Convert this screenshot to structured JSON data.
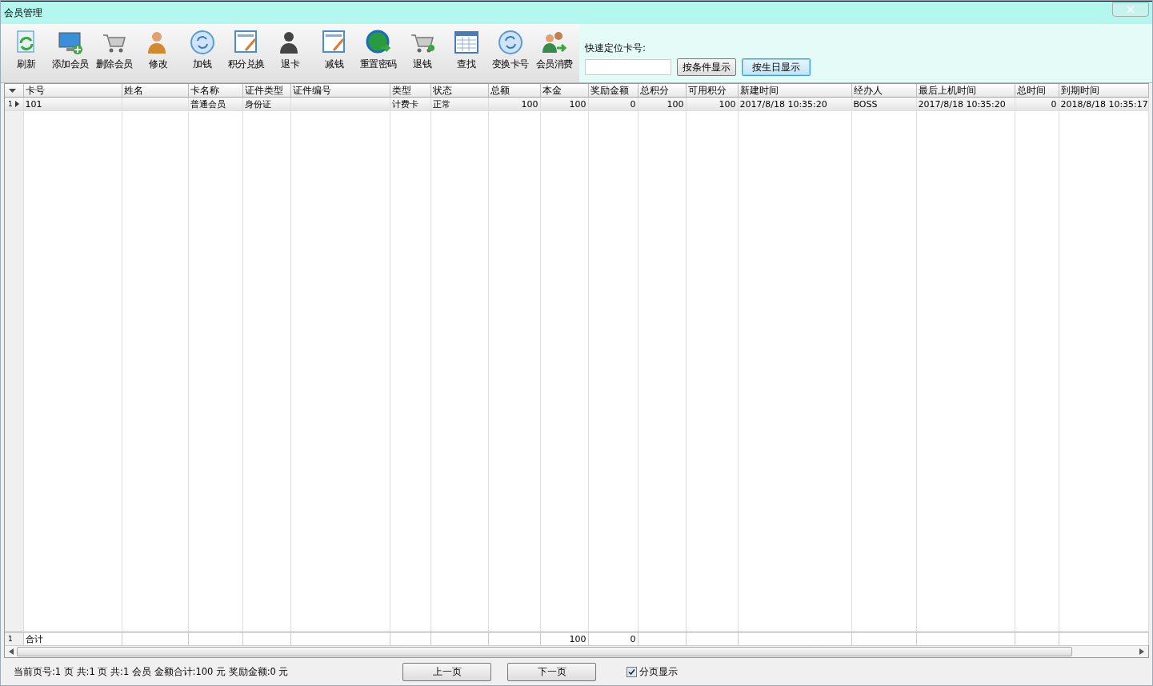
{
  "window": {
    "title": "会员管理"
  },
  "toolbar": [
    {
      "label": "刷新"
    },
    {
      "label": "添加会员"
    },
    {
      "label": "删除会员"
    },
    {
      "label": "修改"
    },
    {
      "label": "加钱"
    },
    {
      "label": "积分兑换"
    },
    {
      "label": "退卡"
    },
    {
      "label": "减钱"
    },
    {
      "label": "重置密码"
    },
    {
      "label": "退钱"
    },
    {
      "label": "查找"
    },
    {
      "label": "变换卡号"
    },
    {
      "label": "会员消费"
    }
  ],
  "quick_locate": {
    "label": "快速定位卡号:"
  },
  "filter_buttons": [
    {
      "label": "按条件显示",
      "selected": false
    },
    {
      "label": "按生日显示",
      "selected": true
    }
  ],
  "table": {
    "columns": [
      {
        "label": "卡号",
        "kind": "text"
      },
      {
        "label": "姓名",
        "kind": "text"
      },
      {
        "label": "卡名称",
        "kind": "text"
      },
      {
        "label": "证件类型",
        "kind": "text"
      },
      {
        "label": "证件编号",
        "kind": "text"
      },
      {
        "label": "类型",
        "kind": "text"
      },
      {
        "label": "状态",
        "kind": "text"
      },
      {
        "label": "总额",
        "kind": "number"
      },
      {
        "label": "本金",
        "kind": "number"
      },
      {
        "label": "奖励金额",
        "kind": "number"
      },
      {
        "label": "总积分",
        "kind": "number"
      },
      {
        "label": "可用积分",
        "kind": "number"
      },
      {
        "label": "新建时间",
        "kind": "text"
      },
      {
        "label": "经办人",
        "kind": "text"
      },
      {
        "label": "最后上机时间",
        "kind": "text"
      },
      {
        "label": "总时间",
        "kind": "number"
      },
      {
        "label": "到期时间",
        "kind": "text"
      }
    ],
    "rows": [
      {
        "index": "1",
        "selected": true,
        "cells": [
          "101",
          "",
          "普通会员",
          "身份证",
          "",
          "计费卡",
          "正常",
          "100",
          "100",
          "0",
          "100",
          "100",
          "2017/8/18 10:35:20",
          "BOSS",
          "2017/8/18 10:35:20",
          "0",
          "2018/8/18 10:35:17"
        ]
      }
    ],
    "totals": {
      "index": "1",
      "cells": [
        "合计",
        "",
        "",
        "",
        "",
        "",
        "",
        "",
        "100",
        "0",
        "",
        "",
        "",
        "",
        "",
        "",
        ""
      ]
    }
  },
  "status_bar": {
    "text": "当前页号:1 页 共:1 页 共:1 会员 金额合计:100 元 奖励金额:0 元",
    "prev": "上一页",
    "next": "下一页",
    "paging": {
      "label": "分页显示",
      "checked": true
    }
  }
}
